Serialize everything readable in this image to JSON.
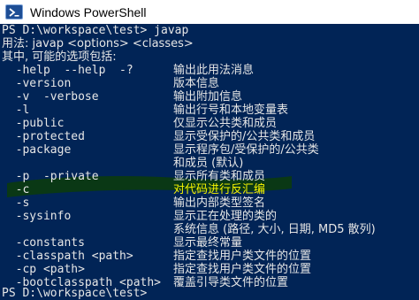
{
  "window": {
    "title": "Windows PowerShell",
    "icon": "powershell-icon"
  },
  "console": {
    "prompt_command": "PS D:\\workspace\\test> javap",
    "usage": "用法: javap <options> <classes>",
    "options_intro": "其中, 可能的选项包括:",
    "options": [
      {
        "flag": "  -help  --help  -?",
        "desc": "输出此用法消息"
      },
      {
        "flag": "  -version",
        "desc": "版本信息"
      },
      {
        "flag": "  -v  -verbose",
        "desc": "输出附加信息"
      },
      {
        "flag": "  -l",
        "desc": "输出行号和本地变量表"
      },
      {
        "flag": "  -public",
        "desc": "仅显示公共类和成员"
      },
      {
        "flag": "  -protected",
        "desc": "显示受保护的/公共类和成员"
      },
      {
        "flag": "  -package",
        "desc": "显示程序包/受保护的/公共类"
      },
      {
        "flag": "",
        "desc": "和成员 (默认)"
      },
      {
        "flag": "  -p  -private",
        "desc": "显示所有类和成员"
      },
      {
        "flag": "  -c",
        "desc": "对代码进行反汇编"
      },
      {
        "flag": "  -s",
        "desc": "输出内部类型签名"
      },
      {
        "flag": "  -sysinfo",
        "desc": "显示正在处理的类的"
      },
      {
        "flag": "",
        "desc": "系统信息 (路径, 大小, 日期, MD5 散列)"
      },
      {
        "flag": "  -constants",
        "desc": "显示最终常量"
      },
      {
        "flag": "  -classpath <path>",
        "desc": "指定查找用户类文件的位置"
      },
      {
        "flag": "  -cp <path>",
        "desc": "指定查找用户类文件的位置"
      },
      {
        "flag": "  -bootclasspath <path>",
        "desc": "覆盖引导类文件的位置"
      }
    ],
    "final_prompt": "PS D:\\workspace\\test>"
  },
  "colors": {
    "background": "#012456",
    "text": "#e6e6e6",
    "annotation_stroke": "#0b3a12",
    "annotation_text": "#f7f500"
  }
}
